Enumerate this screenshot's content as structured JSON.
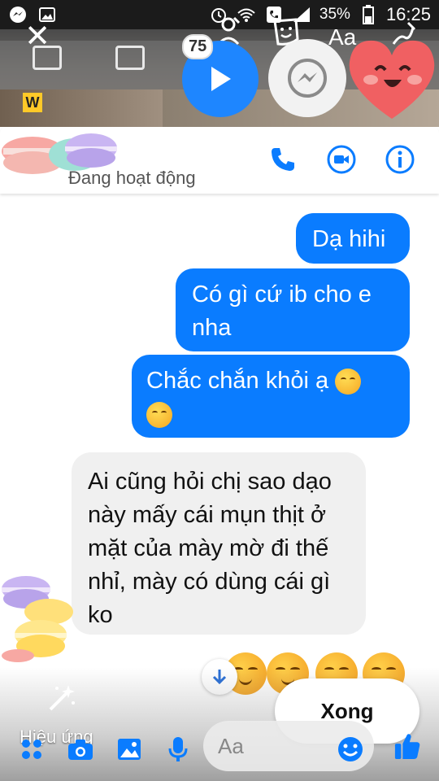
{
  "statusbar": {
    "battery": "35%",
    "time": "16:25"
  },
  "editor": {
    "badge_count": "75",
    "text_tool_label": "Aa",
    "photo_letter": "W"
  },
  "header": {
    "status": "Đang hoạt động"
  },
  "messages": [
    {
      "sender": "me",
      "text": "Dạ hihi"
    },
    {
      "sender": "me",
      "text": "Có gì cứ ib cho e nha"
    },
    {
      "sender": "me",
      "text": "Chắc chắn khỏi ạ"
    },
    {
      "sender": "them",
      "text": "Ai cũng hỏi chị sao dạo này mấy cái mụn thịt ở mặt của mày mờ đi thế nhỉ, mày có dùng cái gì ko"
    }
  ],
  "bottom": {
    "effects_label": "Hiệu ứng",
    "done_label": "Xong",
    "input_placeholder": "Aa"
  },
  "icons": {
    "accent": "#0a7cff",
    "header_icons": [
      "phone-icon",
      "video-call-icon",
      "info-icon"
    ],
    "composer_icons": [
      "apps-icon",
      "camera-icon",
      "gallery-icon",
      "microphone-icon",
      "emoji-icon",
      "thumbs-up-icon"
    ]
  }
}
